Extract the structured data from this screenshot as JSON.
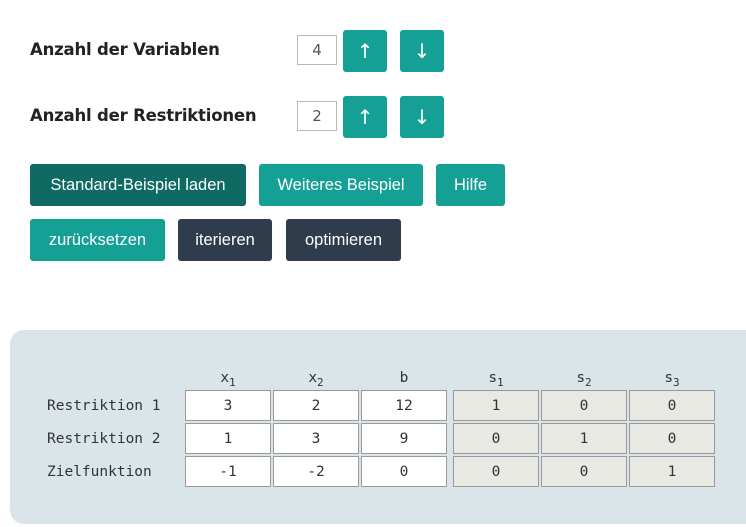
{
  "settings": {
    "variables": {
      "label": "Anzahl der Variablen",
      "value": "4"
    },
    "restrictions": {
      "label": "Anzahl der Restriktionen",
      "value": "2"
    },
    "up_glyph": "↑",
    "down_glyph": "↓"
  },
  "buttons": {
    "load_standard": "Standard-Beispiel laden",
    "another_example": "Weiteres Beispiel",
    "help": "Hilfe",
    "reset": "zurücksetzen",
    "iterate": "iterieren",
    "optimize": "optimieren"
  },
  "table": {
    "columns": [
      {
        "base": "x",
        "sub": "1"
      },
      {
        "base": "x",
        "sub": "2"
      },
      {
        "base": "b",
        "sub": ""
      },
      {
        "base": "s",
        "sub": "1"
      },
      {
        "base": "s",
        "sub": "2"
      },
      {
        "base": "s",
        "sub": "3"
      }
    ],
    "rows": [
      {
        "label": "Restriktion 1",
        "cells": [
          "3",
          "2",
          "12",
          "1",
          "0",
          "0"
        ]
      },
      {
        "label": "Restriktion 2",
        "cells": [
          "1",
          "3",
          "9",
          "0",
          "1",
          "0"
        ]
      },
      {
        "label": "Zielfunktion",
        "cells": [
          "-1",
          "-2",
          "0",
          "0",
          "0",
          "1"
        ]
      }
    ]
  },
  "colors": {
    "teal": "#15a095",
    "teal_dark": "#0e6a62",
    "slate": "#2f3c4c",
    "panel": "#dae5ea",
    "slack_cell": "#e9e9e4"
  }
}
